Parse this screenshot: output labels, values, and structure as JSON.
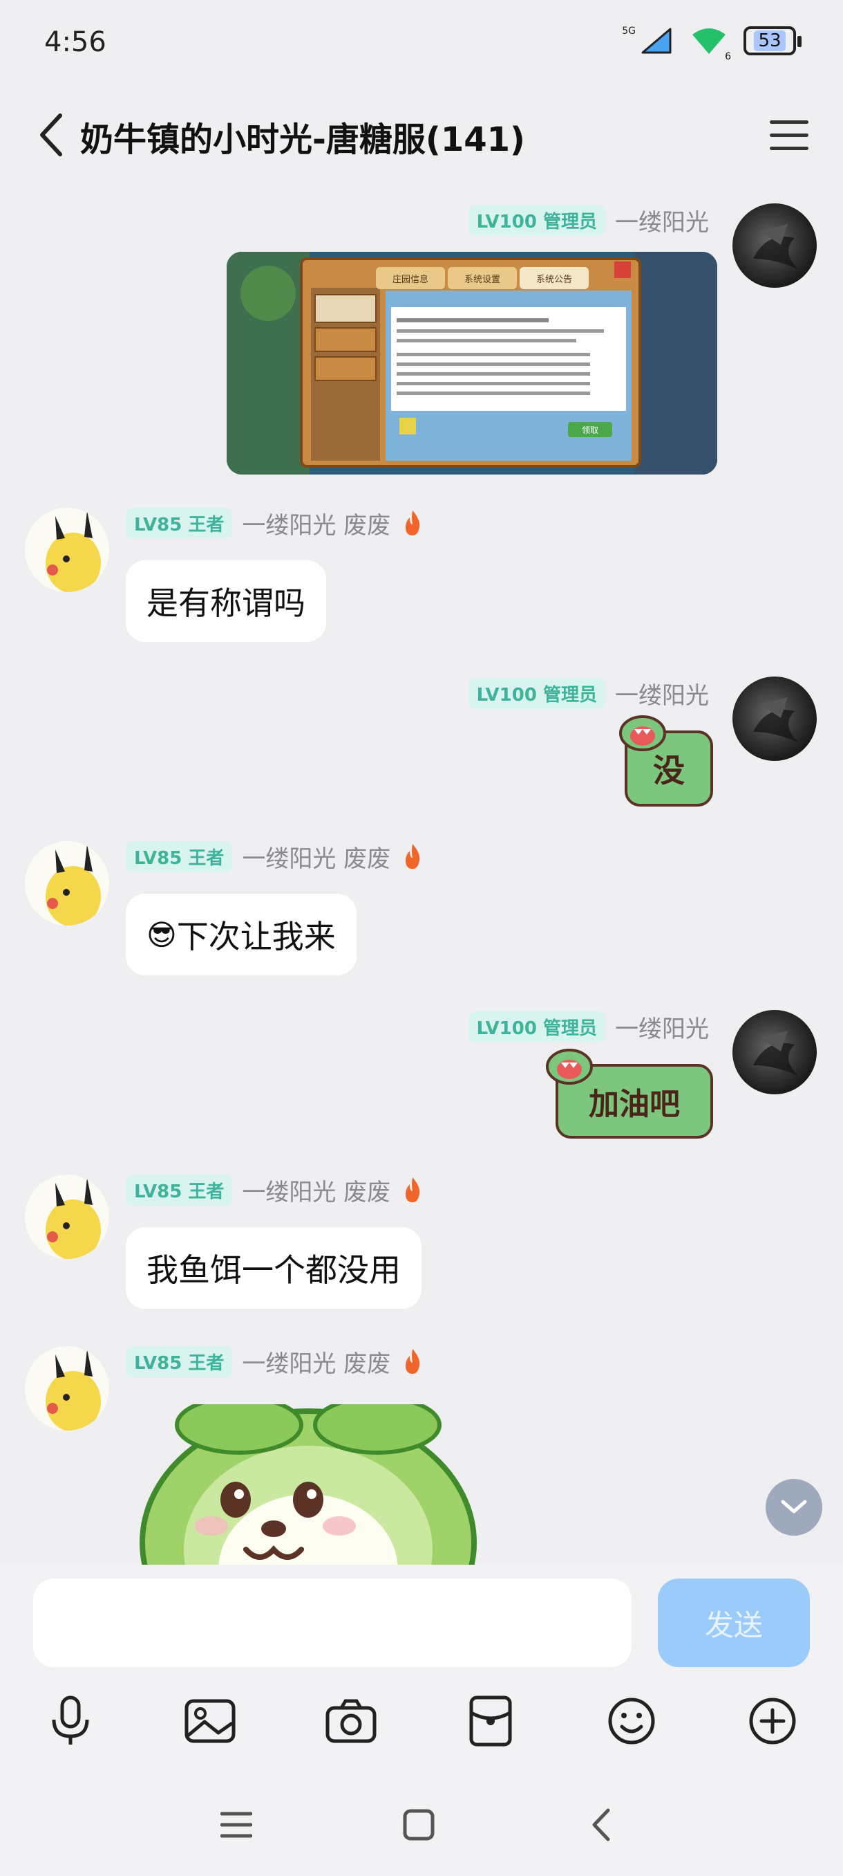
{
  "status_bar": {
    "time": "4:56",
    "network": "5G",
    "wifi_level": "6",
    "battery": "53"
  },
  "header": {
    "title": "奶牛镇的小时光-唐糖服(141)"
  },
  "messages": [
    {
      "side": "right",
      "badge": "LV100 管理员",
      "name": "一缕阳光",
      "type": "image",
      "game_tabs": [
        "庄园信息",
        "系统设置",
        "系统公告"
      ],
      "game_button": "领取"
    },
    {
      "side": "left",
      "badge": "LV85 王者",
      "name": "一缕阳光 废废",
      "type": "text",
      "text": "是有称谓吗"
    },
    {
      "side": "right",
      "badge": "LV100 管理员",
      "name": "一缕阳光",
      "type": "sticker",
      "sticker_text": "没"
    },
    {
      "side": "left",
      "badge": "LV85 王者",
      "name": "一缕阳光 废废",
      "type": "text",
      "emoji": "😎",
      "text": "下次让我来"
    },
    {
      "side": "right",
      "badge": "LV100 管理员",
      "name": "一缕阳光",
      "type": "sticker",
      "sticker_text": "加油吧"
    },
    {
      "side": "left",
      "badge": "LV85 王者",
      "name": "一缕阳光 废废",
      "type": "text",
      "text": "我鱼饵一个都没用"
    },
    {
      "side": "left",
      "badge": "LV85 王者",
      "name": "一缕阳光 废废",
      "type": "sticker_large"
    }
  ],
  "composer": {
    "placeholder": "",
    "send_label": "发送"
  },
  "toolbar": [
    "mic-icon",
    "image-icon",
    "camera-icon",
    "red-packet-icon",
    "emoji-icon",
    "plus-icon"
  ],
  "colors": {
    "badge_bg": "#d9f4ee",
    "badge_text": "#3fb39a",
    "send_button": "#9bcbf9",
    "background": "#efeff1"
  }
}
